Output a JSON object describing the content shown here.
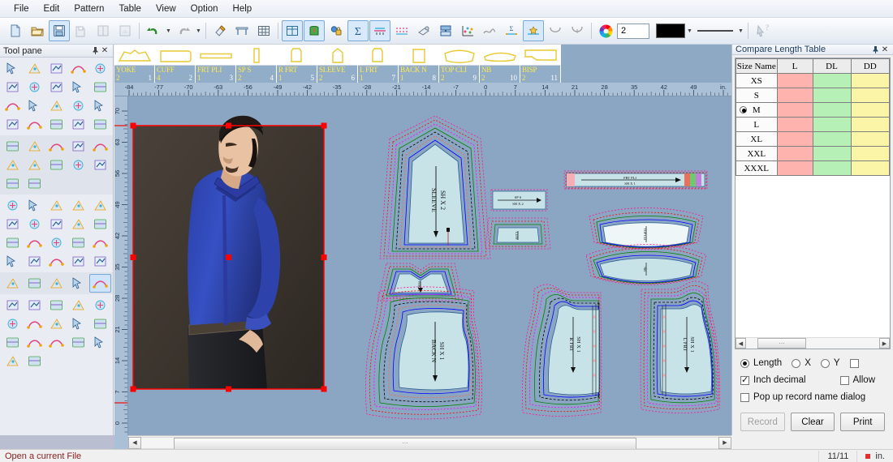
{
  "app": {
    "status_message": "Open a current File",
    "status_page": "11/11",
    "status_unit": "in."
  },
  "menu": {
    "items": [
      "File",
      "Edit",
      "Pattern",
      "Table",
      "View",
      "Option",
      "Help"
    ]
  },
  "toolbar": {
    "icons": [
      {
        "name": "new-file-icon",
        "active": false
      },
      {
        "name": "open-folder-icon",
        "active": false
      },
      {
        "name": "save-icon",
        "active": true
      },
      {
        "name": "save-as-icon",
        "active": false
      },
      {
        "name": "save-piece-icon",
        "active": false
      },
      {
        "name": "save-marker-icon",
        "active": false
      },
      {
        "name": "undo-icon",
        "active": false
      },
      {
        "name": "redo-icon",
        "active": false
      },
      {
        "name": "eraser-icon",
        "active": false
      },
      {
        "name": "plotter-icon",
        "active": false
      },
      {
        "name": "grid-table-icon",
        "active": false
      },
      {
        "name": "window-grid-icon",
        "active": true
      },
      {
        "name": "piece-green-icon",
        "active": true
      },
      {
        "name": "lock-color-icon",
        "active": false
      },
      {
        "name": "sum-sigma-icon",
        "active": true
      },
      {
        "name": "measure-tape-icon",
        "active": true
      },
      {
        "name": "compare-lines-icon",
        "active": false
      },
      {
        "name": "airbrush-icon",
        "active": false
      },
      {
        "name": "nest-pieces-icon",
        "active": false
      },
      {
        "name": "scatter-points-icon",
        "active": false
      },
      {
        "name": "curve-graph-icon",
        "active": false
      },
      {
        "name": "measure-sigma-icon",
        "active": false
      },
      {
        "name": "measure-star-icon",
        "active": true
      },
      {
        "name": "curve-down-icon",
        "active": false
      },
      {
        "name": "curve-notch-icon",
        "active": false
      },
      {
        "name": "color-wheel-icon",
        "active": false
      }
    ],
    "line_width": "2",
    "line_color": "#000000",
    "help_arrow": "help-pointer-icon"
  },
  "toolpane": {
    "title": "Tool pane",
    "pin_icon": "pin-icon",
    "close_icon": "close-icon",
    "groups": [
      {
        "name": "draw-tools",
        "alt": false,
        "icons": [
          "select-arrow-icon",
          "point-edit-icon",
          "add-point-icon",
          "pen-icon",
          "highlighter-icon",
          "brush-path-icon",
          "node-line-icon",
          "multi-node-icon",
          "vector-point-icon",
          "corner-point-icon",
          "bezier-curve-icon",
          "arc-curve-icon",
          "scissors-icon",
          "offset-shape-icon",
          "two-circles-icon",
          "cut-path-icon",
          "intersect-icon",
          "letter-a-icon",
          "compass-icon",
          "protractor-icon"
        ]
      },
      {
        "name": "transform-tools",
        "alt": true,
        "icons": [
          "align-blocks-icon",
          "mirror-icon",
          "flip-shape-icon",
          "fill-bucket-icon",
          "line-styles-icon",
          "dart-spread-icon",
          "fold-icon",
          "pleat-icon",
          "spiral-icon",
          "t-square-icon",
          "pleat-series-icon",
          "link-chain-icon"
        ]
      },
      {
        "name": "piece-tools",
        "alt": false,
        "icons": [
          "select-piece-icon",
          "pocket-icon",
          "sleeve-piece-icon",
          "seam-shift-icon",
          "piece-point-icon",
          "seam-arrow-icon",
          "seam-measure-icon",
          "button-icon",
          "grommet-icon",
          "piece-corner-icon",
          "piece-rotate-icon",
          "piece-merge-icon",
          "piece-split-icon",
          "piece-flip-icon",
          "piece-outline-icon",
          "two-pieces-icon",
          "piece-pin-icon",
          "piece-stack-icon",
          "ruffle-icon",
          "drape-icon"
        ]
      },
      {
        "name": "grade-tools",
        "alt": true,
        "icons": [
          "grade-box-icon",
          "grade-line-icon",
          "sew-machine-icon",
          "grade-node-icon",
          "stack-layers-icon"
        ]
      },
      {
        "name": "measure-tools",
        "alt": false,
        "icons": [
          "bbox-scale-icon",
          "step-offset-icon",
          "grade-table-icon",
          "grade-copy-icon",
          "grade-rotate-icon",
          "corner-grade-icon",
          "curve-grade-icon",
          "axis-grade-icon",
          "piece-grade-icon",
          "rainbow-grade-icon",
          "nest-box-icon",
          "grade-fan-icon",
          "grade-spread-icon",
          "grade-star-icon",
          "grade-cross-icon",
          "grade-center-icon",
          "grade-split-icon"
        ]
      }
    ]
  },
  "pattern_tabs": [
    {
      "name": "YOKE",
      "qty": "2",
      "index": "1",
      "shape": "yoke"
    },
    {
      "name": "CUFF",
      "qty": "4",
      "index": "2",
      "shape": "cuff"
    },
    {
      "name": "FRT PLI",
      "qty": "1",
      "index": "3",
      "shape": "strip"
    },
    {
      "name": "SP S",
      "qty": "2",
      "index": "4",
      "shape": "narrow"
    },
    {
      "name": "R FRT",
      "qty": "1",
      "index": "5",
      "shape": "front"
    },
    {
      "name": "SLEEVE",
      "qty": "2",
      "index": "6",
      "shape": "sleeve"
    },
    {
      "name": "L FRT",
      "qty": "1",
      "index": "7",
      "shape": "front"
    },
    {
      "name": "BACK N",
      "qty": "1",
      "index": "8",
      "shape": "back"
    },
    {
      "name": "TOP CLI",
      "qty": "2",
      "index": "9",
      "shape": "collar"
    },
    {
      "name": "NB",
      "qty": "2",
      "index": "10",
      "shape": "band"
    },
    {
      "name": "BISP",
      "qty": "2",
      "index": "11",
      "shape": "bisp"
    }
  ],
  "rulers": {
    "horizontal_ticks": [
      "-84",
      "-77",
      "-70",
      "-63",
      "-56",
      "-49",
      "-42",
      "-35",
      "-28",
      "-21",
      "-14",
      "-7",
      "0",
      "7",
      "14",
      "21",
      "28",
      "35",
      "42",
      "49",
      "in."
    ],
    "vertical_ticks": [
      "70",
      "63",
      "56",
      "49",
      "42",
      "35",
      "28",
      "21",
      "14",
      "7",
      "0"
    ]
  },
  "canvas": {
    "background_color": "#8ba6c2",
    "piece_fill": "#c7e3e8",
    "image": {
      "name": "model-photo",
      "alt": "Male model wearing blue dress shirt",
      "selected": true,
      "selection_color": "#ff0000"
    },
    "pieces": [
      {
        "name": "sleeve-piece",
        "label_line1": "SLEEVE",
        "label_line2": "SH X 2"
      },
      {
        "name": "back-piece",
        "label_line1": "BACK N",
        "label_line2": "SH X 1"
      },
      {
        "name": "right-front-piece",
        "label_line1": "R FRT",
        "label_line2": "SH X 1"
      },
      {
        "name": "left-front-piece",
        "label_line1": "L FRT",
        "label_line2": "SH X 1"
      },
      {
        "name": "front-placket-piece",
        "label_line1": "FRT PLI",
        "label_line2": "SH X 1"
      },
      {
        "name": "yoke-piece",
        "label_line1": "YOKE",
        "label_line2": "SH X 2"
      },
      {
        "name": "collar-piece",
        "label_line1": "TOP CLI",
        "label_line2": "SH X 2"
      },
      {
        "name": "collar-band-piece",
        "label_line1": "NB",
        "label_line2": "SH X 2"
      },
      {
        "name": "cuff-piece",
        "label_line1": "CUFF",
        "label_line2": "SH X 4"
      },
      {
        "name": "sleeve-placket-piece",
        "label_line1": "SP S",
        "label_line2": "SH X 2"
      }
    ],
    "grading_colors": [
      "#ff1493",
      "#ff0000",
      "#0000ff",
      "#008000",
      "#000000",
      "#ff00ff",
      "#ff6347",
      "#8a2be2"
    ]
  },
  "right_panel": {
    "title": "Compare Length Table",
    "pin_icon": "pin-icon",
    "close_icon": "close-icon",
    "table": {
      "columns": [
        "Size Name",
        "L",
        "DL",
        "DD"
      ],
      "rows": [
        {
          "size": "XS",
          "selected": false,
          "L": "",
          "DL": "",
          "DD": ""
        },
        {
          "size": "S",
          "selected": false,
          "L": "",
          "DL": "",
          "DD": ""
        },
        {
          "size": "M",
          "selected": true,
          "L": "",
          "DL": "",
          "DD": ""
        },
        {
          "size": "L",
          "selected": false,
          "L": "",
          "DL": "",
          "DD": ""
        },
        {
          "size": "XL",
          "selected": false,
          "L": "",
          "DL": "",
          "DD": ""
        },
        {
          "size": "XXL",
          "selected": false,
          "L": "",
          "DL": "",
          "DD": ""
        },
        {
          "size": "XXXL",
          "selected": false,
          "L": "",
          "DL": "",
          "DD": ""
        }
      ],
      "cell_colors": {
        "L": "#ffb3ae",
        "DL": "#b6f0b6",
        "DD": "#fbf5a8"
      }
    },
    "options": {
      "measure_mode": "Length",
      "radio_length": "Length",
      "radio_x": "X",
      "radio_y": "Y",
      "check_inch_decimal": "Inch decimal",
      "check_inch_decimal_on": true,
      "check_allow": "Allow",
      "check_allow_on": false,
      "check_popup": "Pop up record name dialog",
      "check_popup_on": false
    },
    "buttons": {
      "record": "Record",
      "record_disabled": true,
      "clear": "Clear",
      "print": "Print"
    }
  }
}
